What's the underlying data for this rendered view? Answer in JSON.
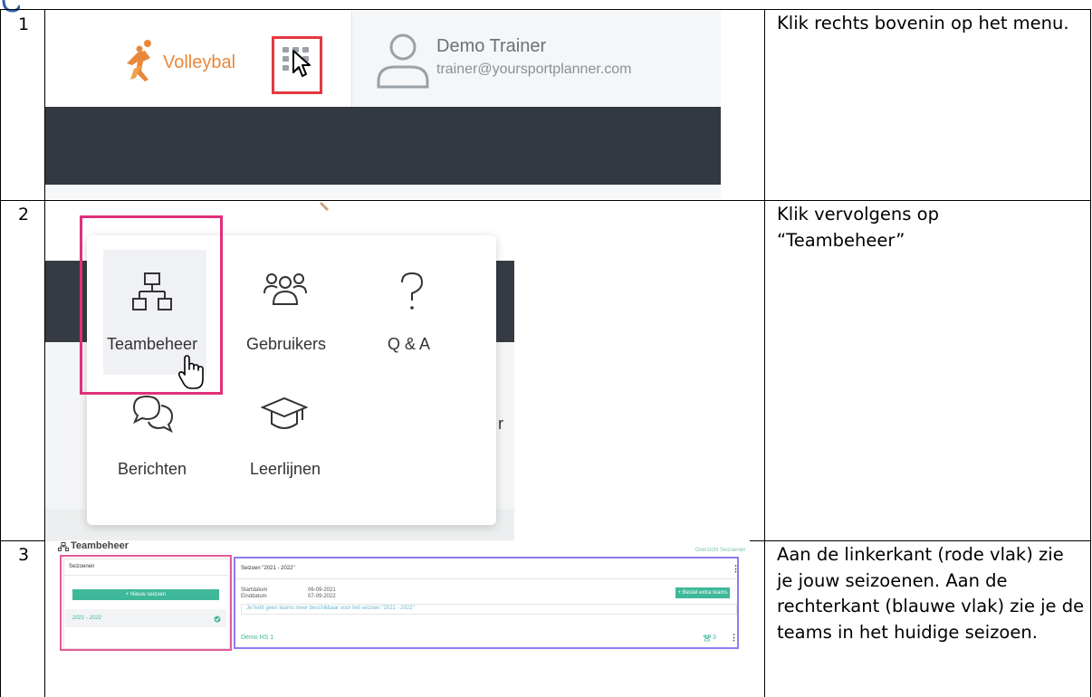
{
  "rows": [
    {
      "number": "1",
      "instruction": "Klik rechts bovenin op het menu."
    },
    {
      "number": "2",
      "instruction": "Klik vervolgens op “Teambeheer”"
    },
    {
      "number": "3",
      "instruction": "Aan de linkerkant (rode vlak) zie je jouw seizoenen. Aan de rechterkant (blauwe vlak) zie je de teams in het huidige seizoen."
    }
  ],
  "step1": {
    "brand": "Volleybal",
    "user_name": "Demo Trainer",
    "user_email": "trainer@yoursportplanner.com",
    "icons": [
      "volleyball-player-icon",
      "apps-grid-icon",
      "cursor-arrow-icon",
      "user-avatar-icon"
    ]
  },
  "step2": {
    "menu_items": [
      "Teambeheer",
      "Gebruikers",
      "Q & A",
      "Berichten",
      "Leerlijnen"
    ],
    "peek_char": "r",
    "icons": [
      "sitemap-icon",
      "users-icon",
      "question-icon",
      "chat-icon",
      "graduation-cap-icon",
      "hand-pointer-icon"
    ]
  },
  "step3": {
    "page_title": "Teambeheer",
    "overview_link": "Overzicht Seizoenen",
    "seasons_header": "Seizoenen",
    "new_season_button": "+ Nieuw seizoen",
    "season_item": "2021 - 2022",
    "season_detail_title": "Seizoen \"2021 - 2022\"",
    "start_label": "Startdatum",
    "start_value": "06-09-2021",
    "end_label": "Einddatum",
    "end_value": "07-09-2022",
    "order_button": "+ Bestel extra teams",
    "notice": "Je hebt geen teams meer beschikbaar voor het seizoen \"2021 - 2022\"",
    "team_name": "Demo HS 1",
    "team_count": "3",
    "colors": {
      "accent": "#3fb89a",
      "red_area": "#e65a9a",
      "blue_area": "#8b7df0"
    }
  }
}
